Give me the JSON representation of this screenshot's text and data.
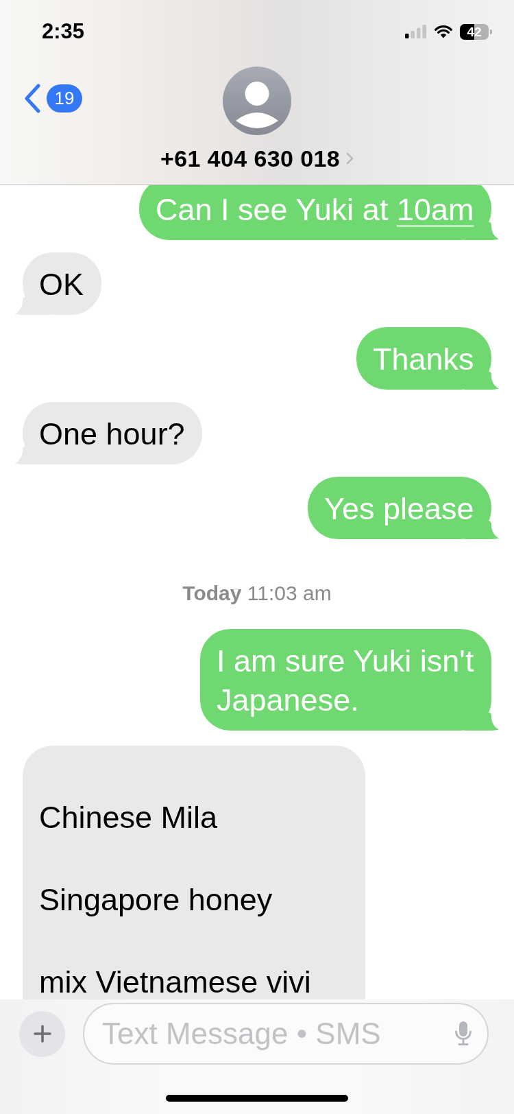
{
  "status_bar": {
    "time": "2:35",
    "battery": "42"
  },
  "header": {
    "back_badge": "19",
    "contact": "+61 404 630 018"
  },
  "conversation": [
    {
      "kind": "sent",
      "text": "Can I see Yuki at",
      "link": "10am"
    },
    {
      "kind": "received",
      "text": "OK"
    },
    {
      "kind": "sent",
      "text": "Thanks"
    },
    {
      "kind": "received",
      "text": "One hour?"
    },
    {
      "kind": "sent",
      "text": "Yes please"
    },
    {
      "kind": "timestamp",
      "text": "**Today** 11:03 am"
    },
    {
      "kind": "sent",
      "text": "I am sure Yuki isn't Japanese."
    },
    {
      "kind": "received",
      "lines": [
        "Chinese Mila",
        "Singapore honey",
        "mix Vietnamese vivi"
      ]
    }
  ],
  "composer": {
    "placeholder": "Text Message • SMS"
  }
}
